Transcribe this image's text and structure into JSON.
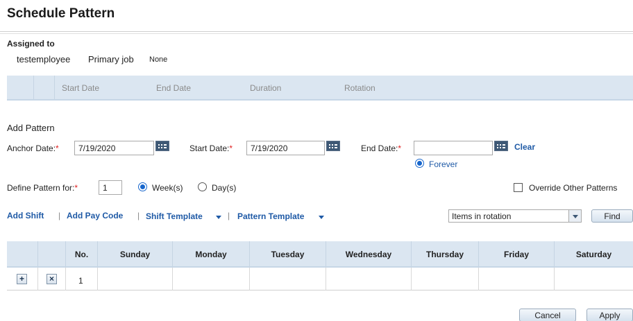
{
  "page": {
    "title": "Schedule Pattern"
  },
  "assigned": {
    "label": "Assigned to",
    "employee": "testemployee",
    "primary_job_label": "Primary job",
    "primary_job_value": "None"
  },
  "patterns_table": {
    "columns": [
      "Start Date",
      "End Date",
      "Duration",
      "Rotation"
    ]
  },
  "add_pattern": {
    "heading": "Add Pattern",
    "anchor_label": "Anchor Date:",
    "anchor_value": "7/19/2020",
    "start_label": "Start Date:",
    "start_value": "7/19/2020",
    "end_label": "End Date:",
    "end_value": "",
    "clear_label": "Clear",
    "forever_label": "Forever",
    "required_mark": "*"
  },
  "define": {
    "label": "Define Pattern for:",
    "value": "1",
    "weeks_label": "Week(s)",
    "days_label": "Day(s)",
    "selected": "weeks",
    "override_label": "Override Other Patterns",
    "override_checked": false
  },
  "toolbar": {
    "add_shift": "Add Shift",
    "add_pay_code": "Add Pay Code",
    "shift_template": "Shift Template",
    "pattern_template": "Pattern Template",
    "separator": "|",
    "filter_value": "Items in rotation",
    "find_label": "Find"
  },
  "schedule_grid": {
    "columns": [
      "No.",
      "Sunday",
      "Monday",
      "Tuesday",
      "Wednesday",
      "Thursday",
      "Friday",
      "Saturday"
    ],
    "rows": [
      {
        "add": "+",
        "remove": "×",
        "no": "1"
      }
    ]
  },
  "footer": {
    "cancel_label": "Cancel",
    "apply_label": "Apply"
  },
  "colors": {
    "accent": "#1f5aa6",
    "header_bg": "#dbe6f1",
    "required": "#e02020",
    "radio": "#1766cc"
  },
  "icons": [
    "calendar-icon",
    "plus-icon",
    "remove-icon",
    "chevron-down-icon"
  ]
}
